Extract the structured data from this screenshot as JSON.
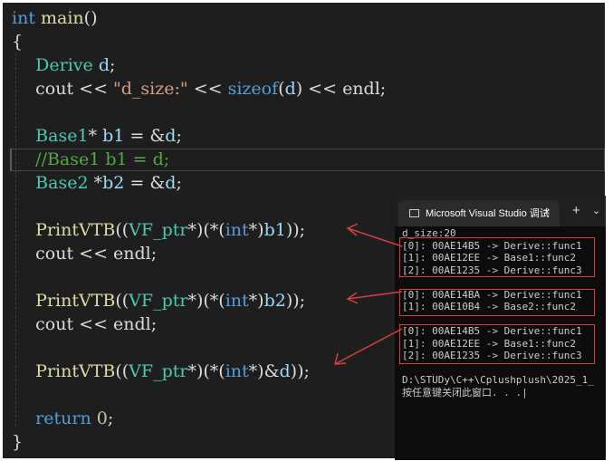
{
  "editor": {
    "lines": [
      [
        {
          "t": "int",
          "c": "kw"
        },
        {
          "t": " ",
          "c": "pl"
        },
        {
          "t": "main",
          "c": "fn"
        },
        {
          "t": "()",
          "c": "pl"
        }
      ],
      [
        {
          "t": "{",
          "c": "pl"
        }
      ],
      [
        {
          "t": "    ",
          "c": "pl"
        },
        {
          "t": "Derive",
          "c": "ty"
        },
        {
          "t": " ",
          "c": "pl"
        },
        {
          "t": "d",
          "c": "var"
        },
        {
          "t": ";",
          "c": "pl"
        }
      ],
      [
        {
          "t": "    cout << ",
          "c": "pl"
        },
        {
          "t": "\"d_size:\"",
          "c": "str"
        },
        {
          "t": " << ",
          "c": "pl"
        },
        {
          "t": "sizeof",
          "c": "kw"
        },
        {
          "t": "(",
          "c": "pl"
        },
        {
          "t": "d",
          "c": "var"
        },
        {
          "t": ") << endl;",
          "c": "pl"
        }
      ],
      [],
      [
        {
          "t": "    ",
          "c": "pl"
        },
        {
          "t": "Base1",
          "c": "ty"
        },
        {
          "t": "* ",
          "c": "pl"
        },
        {
          "t": "b1",
          "c": "var"
        },
        {
          "t": " = &",
          "c": "pl"
        },
        {
          "t": "d",
          "c": "var"
        },
        {
          "t": ";",
          "c": "pl"
        }
      ],
      [
        {
          "t": "    ",
          "c": "pl"
        },
        {
          "t": "//Base1 b1 = d;",
          "c": "cm"
        }
      ],
      [
        {
          "t": "    ",
          "c": "pl"
        },
        {
          "t": "Base2",
          "c": "ty"
        },
        {
          "t": " *",
          "c": "pl"
        },
        {
          "t": "b2",
          "c": "var"
        },
        {
          "t": " = &",
          "c": "pl"
        },
        {
          "t": "d",
          "c": "var"
        },
        {
          "t": ";",
          "c": "pl"
        }
      ],
      [],
      [
        {
          "t": "    ",
          "c": "pl"
        },
        {
          "t": "PrintVTB",
          "c": "fn"
        },
        {
          "t": "((",
          "c": "pl"
        },
        {
          "t": "VF_ptr",
          "c": "ty"
        },
        {
          "t": "*)(*(",
          "c": "pl"
        },
        {
          "t": "int",
          "c": "kw"
        },
        {
          "t": "*)",
          "c": "pl"
        },
        {
          "t": "b1",
          "c": "var"
        },
        {
          "t": "));",
          "c": "pl"
        }
      ],
      [
        {
          "t": "    cout << endl;",
          "c": "pl"
        }
      ],
      [],
      [
        {
          "t": "    ",
          "c": "pl"
        },
        {
          "t": "PrintVTB",
          "c": "fn"
        },
        {
          "t": "((",
          "c": "pl"
        },
        {
          "t": "VF_ptr",
          "c": "ty"
        },
        {
          "t": "*)(*(",
          "c": "pl"
        },
        {
          "t": "int",
          "c": "kw"
        },
        {
          "t": "*)",
          "c": "pl"
        },
        {
          "t": "b2",
          "c": "var"
        },
        {
          "t": "));",
          "c": "pl"
        }
      ],
      [
        {
          "t": "    cout << endl;",
          "c": "pl"
        }
      ],
      [],
      [
        {
          "t": "    ",
          "c": "pl"
        },
        {
          "t": "PrintVTB",
          "c": "fn"
        },
        {
          "t": "((",
          "c": "pl"
        },
        {
          "t": "VF_ptr",
          "c": "ty"
        },
        {
          "t": "*)(*(",
          "c": "pl"
        },
        {
          "t": "int",
          "c": "kw"
        },
        {
          "t": "*)&",
          "c": "pl"
        },
        {
          "t": "d",
          "c": "var"
        },
        {
          "t": "));",
          "c": "pl"
        }
      ],
      [],
      [
        {
          "t": "    ",
          "c": "pl"
        },
        {
          "t": "return",
          "c": "kw"
        },
        {
          "t": " ",
          "c": "pl"
        },
        {
          "t": "0",
          "c": "num"
        },
        {
          "t": ";",
          "c": "pl"
        }
      ],
      [
        {
          "t": "}",
          "c": "pl"
        }
      ]
    ]
  },
  "console": {
    "tab_title": "Microsoft Visual Studio 调试",
    "close_glyph": "×",
    "new_tab_glyph": "+",
    "dropdown_glyph": "⌄",
    "lines": [
      "d_size:20",
      "[0]: 00AE14B5 -> Derive::func1",
      "[1]: 00AE12EE -> Base1::func2",
      "[2]: 00AE1235 -> Derive::func3",
      "",
      "[0]: 00AE14BA -> Derive::func1",
      "[1]: 00AE10B4 -> Base2::func2",
      "",
      "[0]: 00AE14B5 -> Derive::func1",
      "[1]: 00AE12EE -> Base1::func2",
      "[2]: 00AE1235 -> Derive::func3",
      "",
      "D:\\STUDy\\C++\\Cplushplush\\2025_1_",
      "按任意键关闭此窗口. . .|"
    ]
  },
  "colors": {
    "editor_bg": "#1e1e1e",
    "keyword": "#569cd6",
    "function": "#dcdcaa",
    "type": "#4ec9b0",
    "variable": "#9cdcfe",
    "string": "#d69d85",
    "comment": "#57a64a",
    "annotation": "#d24040"
  }
}
